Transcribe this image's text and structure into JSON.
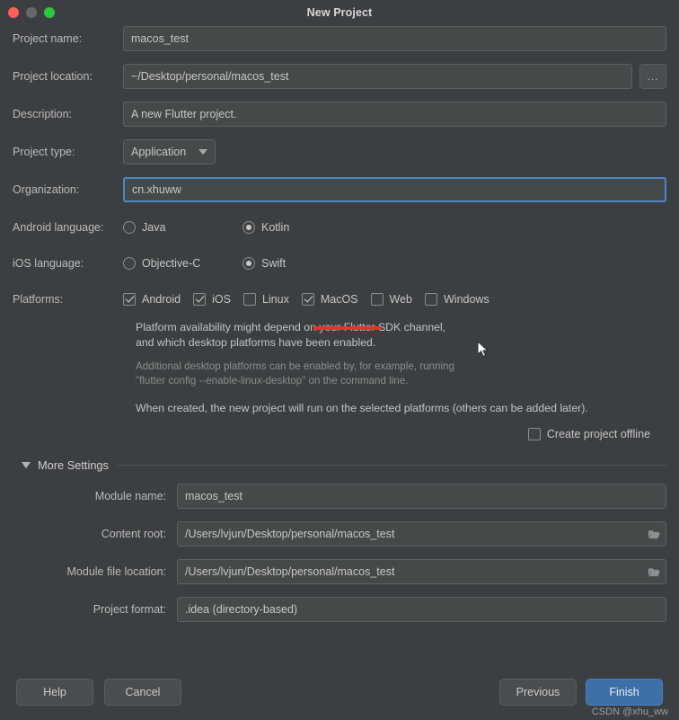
{
  "window": {
    "title": "New Project",
    "traffic_lights": [
      "close",
      "minimize",
      "zoom"
    ]
  },
  "form": {
    "project_name": {
      "label": "Project name:",
      "value": "macos_test"
    },
    "project_location": {
      "label": "Project location:",
      "value": "~/Desktop/personal/macos_test",
      "browse_label": "..."
    },
    "description": {
      "label": "Description:",
      "value": "A new Flutter project."
    },
    "project_type": {
      "label": "Project type:",
      "value": "Application"
    },
    "organization": {
      "label": "Organization:",
      "value": "cn.xhuww",
      "focused": true
    }
  },
  "android_language": {
    "label": "Android language:",
    "options": [
      {
        "label": "Java",
        "selected": false
      },
      {
        "label": "Kotlin",
        "selected": true
      }
    ]
  },
  "ios_language": {
    "label": "iOS language:",
    "options": [
      {
        "label": "Objective-C",
        "selected": false
      },
      {
        "label": "Swift",
        "selected": true
      }
    ]
  },
  "platforms": {
    "label": "Platforms:",
    "items": [
      {
        "label": "Android",
        "checked": true
      },
      {
        "label": "iOS",
        "checked": true
      },
      {
        "label": "Linux",
        "checked": false
      },
      {
        "label": "MacOS",
        "checked": true,
        "highlighted": true
      },
      {
        "label": "Web",
        "checked": false
      },
      {
        "label": "Windows",
        "checked": false
      }
    ]
  },
  "notes": {
    "line1": "Platform availability might depend on your Flutter SDK channel,",
    "line2": "and which desktop platforms have been enabled.",
    "dim1": "Additional desktop platforms can be enabled by, for example, running",
    "dim2": "\"flutter config --enable-linux-desktop\" on the command line.",
    "line3": "When created, the new project will run on the selected platforms (others can be added later)."
  },
  "offline": {
    "label": "Create project offline",
    "checked": false
  },
  "more_settings": {
    "title": "More Settings",
    "expanded": true,
    "module_name": {
      "label": "Module name:",
      "value": "macos_test"
    },
    "content_root": {
      "label": "Content root:",
      "value": "/Users/lvjun/Desktop/personal/macos_test"
    },
    "module_file_location": {
      "label": "Module file location:",
      "value": "/Users/lvjun/Desktop/personal/macos_test"
    },
    "project_format": {
      "label": "Project format:",
      "value": ".idea (directory-based)"
    }
  },
  "footer": {
    "help": "Help",
    "cancel": "Cancel",
    "previous": "Previous",
    "finish": "Finish"
  },
  "watermark": "CSDN @xhu_ww",
  "colors": {
    "background": "#3c3f41",
    "field": "#45494a",
    "accent": "#3f6fa8",
    "focus_border": "#4a88c7",
    "highlight_underline": "#e8332a"
  }
}
